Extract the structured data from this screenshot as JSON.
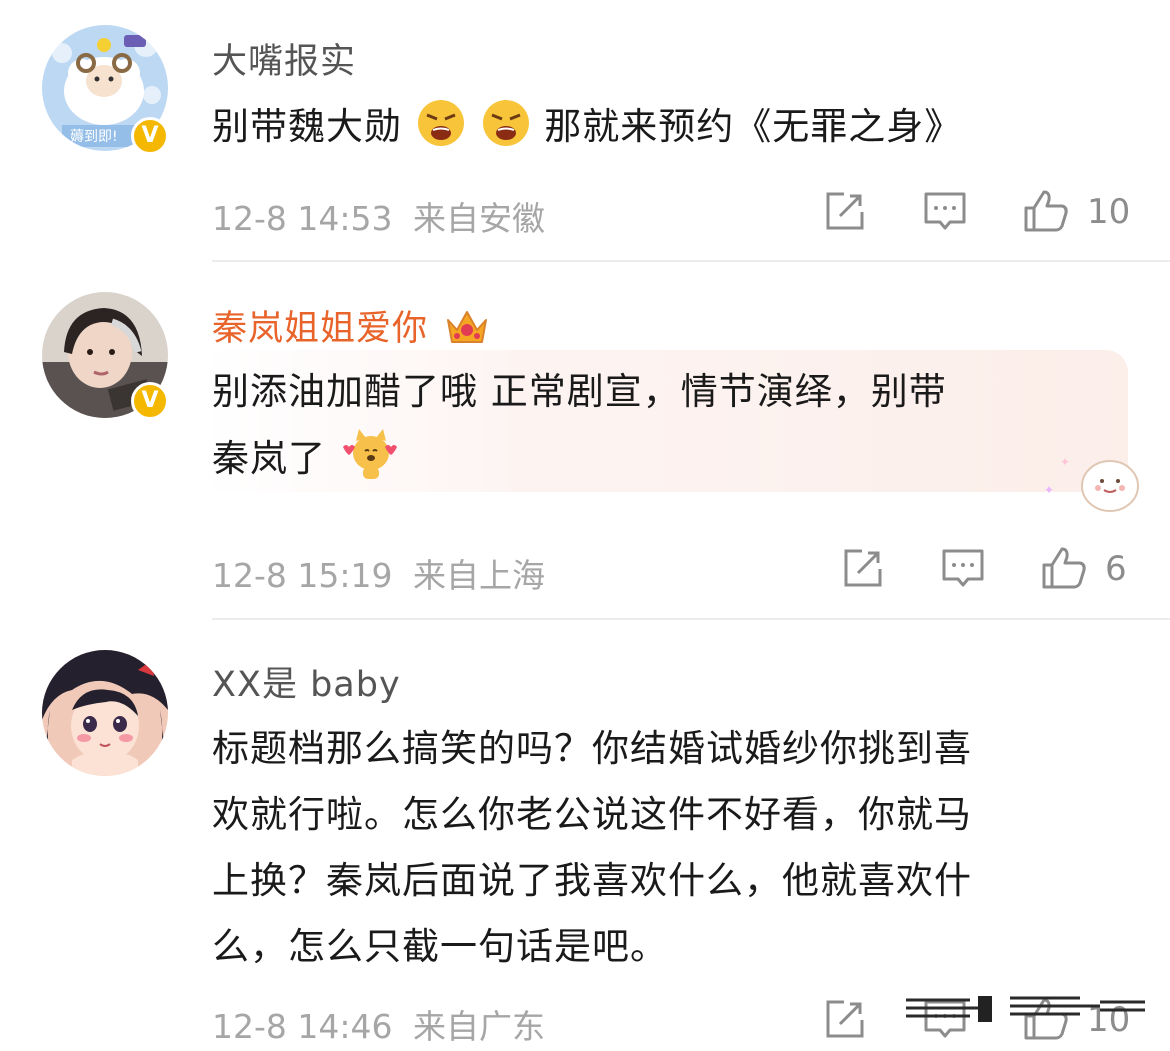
{
  "comments": [
    {
      "username": "大嘴报实",
      "text_part1": "别带魏大勋",
      "text_part2": "那就来预约《无罪之身》",
      "avatar_sticker_text": "薅到即!",
      "time": "12-8 14:53",
      "location": "来自安徽",
      "like_count": "10"
    },
    {
      "username": "秦岚姐姐爱你",
      "text_line1": "别添油加醋了哦 正常剧宣，情节演绎，别带",
      "text_line2": "秦岚了",
      "time": "12-8 15:19",
      "location": "来自上海",
      "like_count": "6"
    },
    {
      "username": "XX是 baby",
      "text_lines": [
        "标题档那么搞笑的吗？你结婚试婚纱你挑到喜",
        "欢就行啦。怎么你老公说这件不好看，你就马",
        "上换？秦岚后面说了我喜欢什么，他就喜欢什",
        "么，怎么只截一句话是吧。"
      ],
      "time": "12-8 14:46",
      "location": "来自广东",
      "like_count": "10"
    }
  ],
  "icons": {
    "repost": "repost-icon",
    "comment": "comment-icon",
    "like": "like-icon",
    "verified": "verified-badge-icon",
    "crown": "vip-crown-icon"
  },
  "colors": {
    "vip_name": "#e8642a",
    "verified": "#f5b800",
    "meta": "#a6a6a6"
  }
}
